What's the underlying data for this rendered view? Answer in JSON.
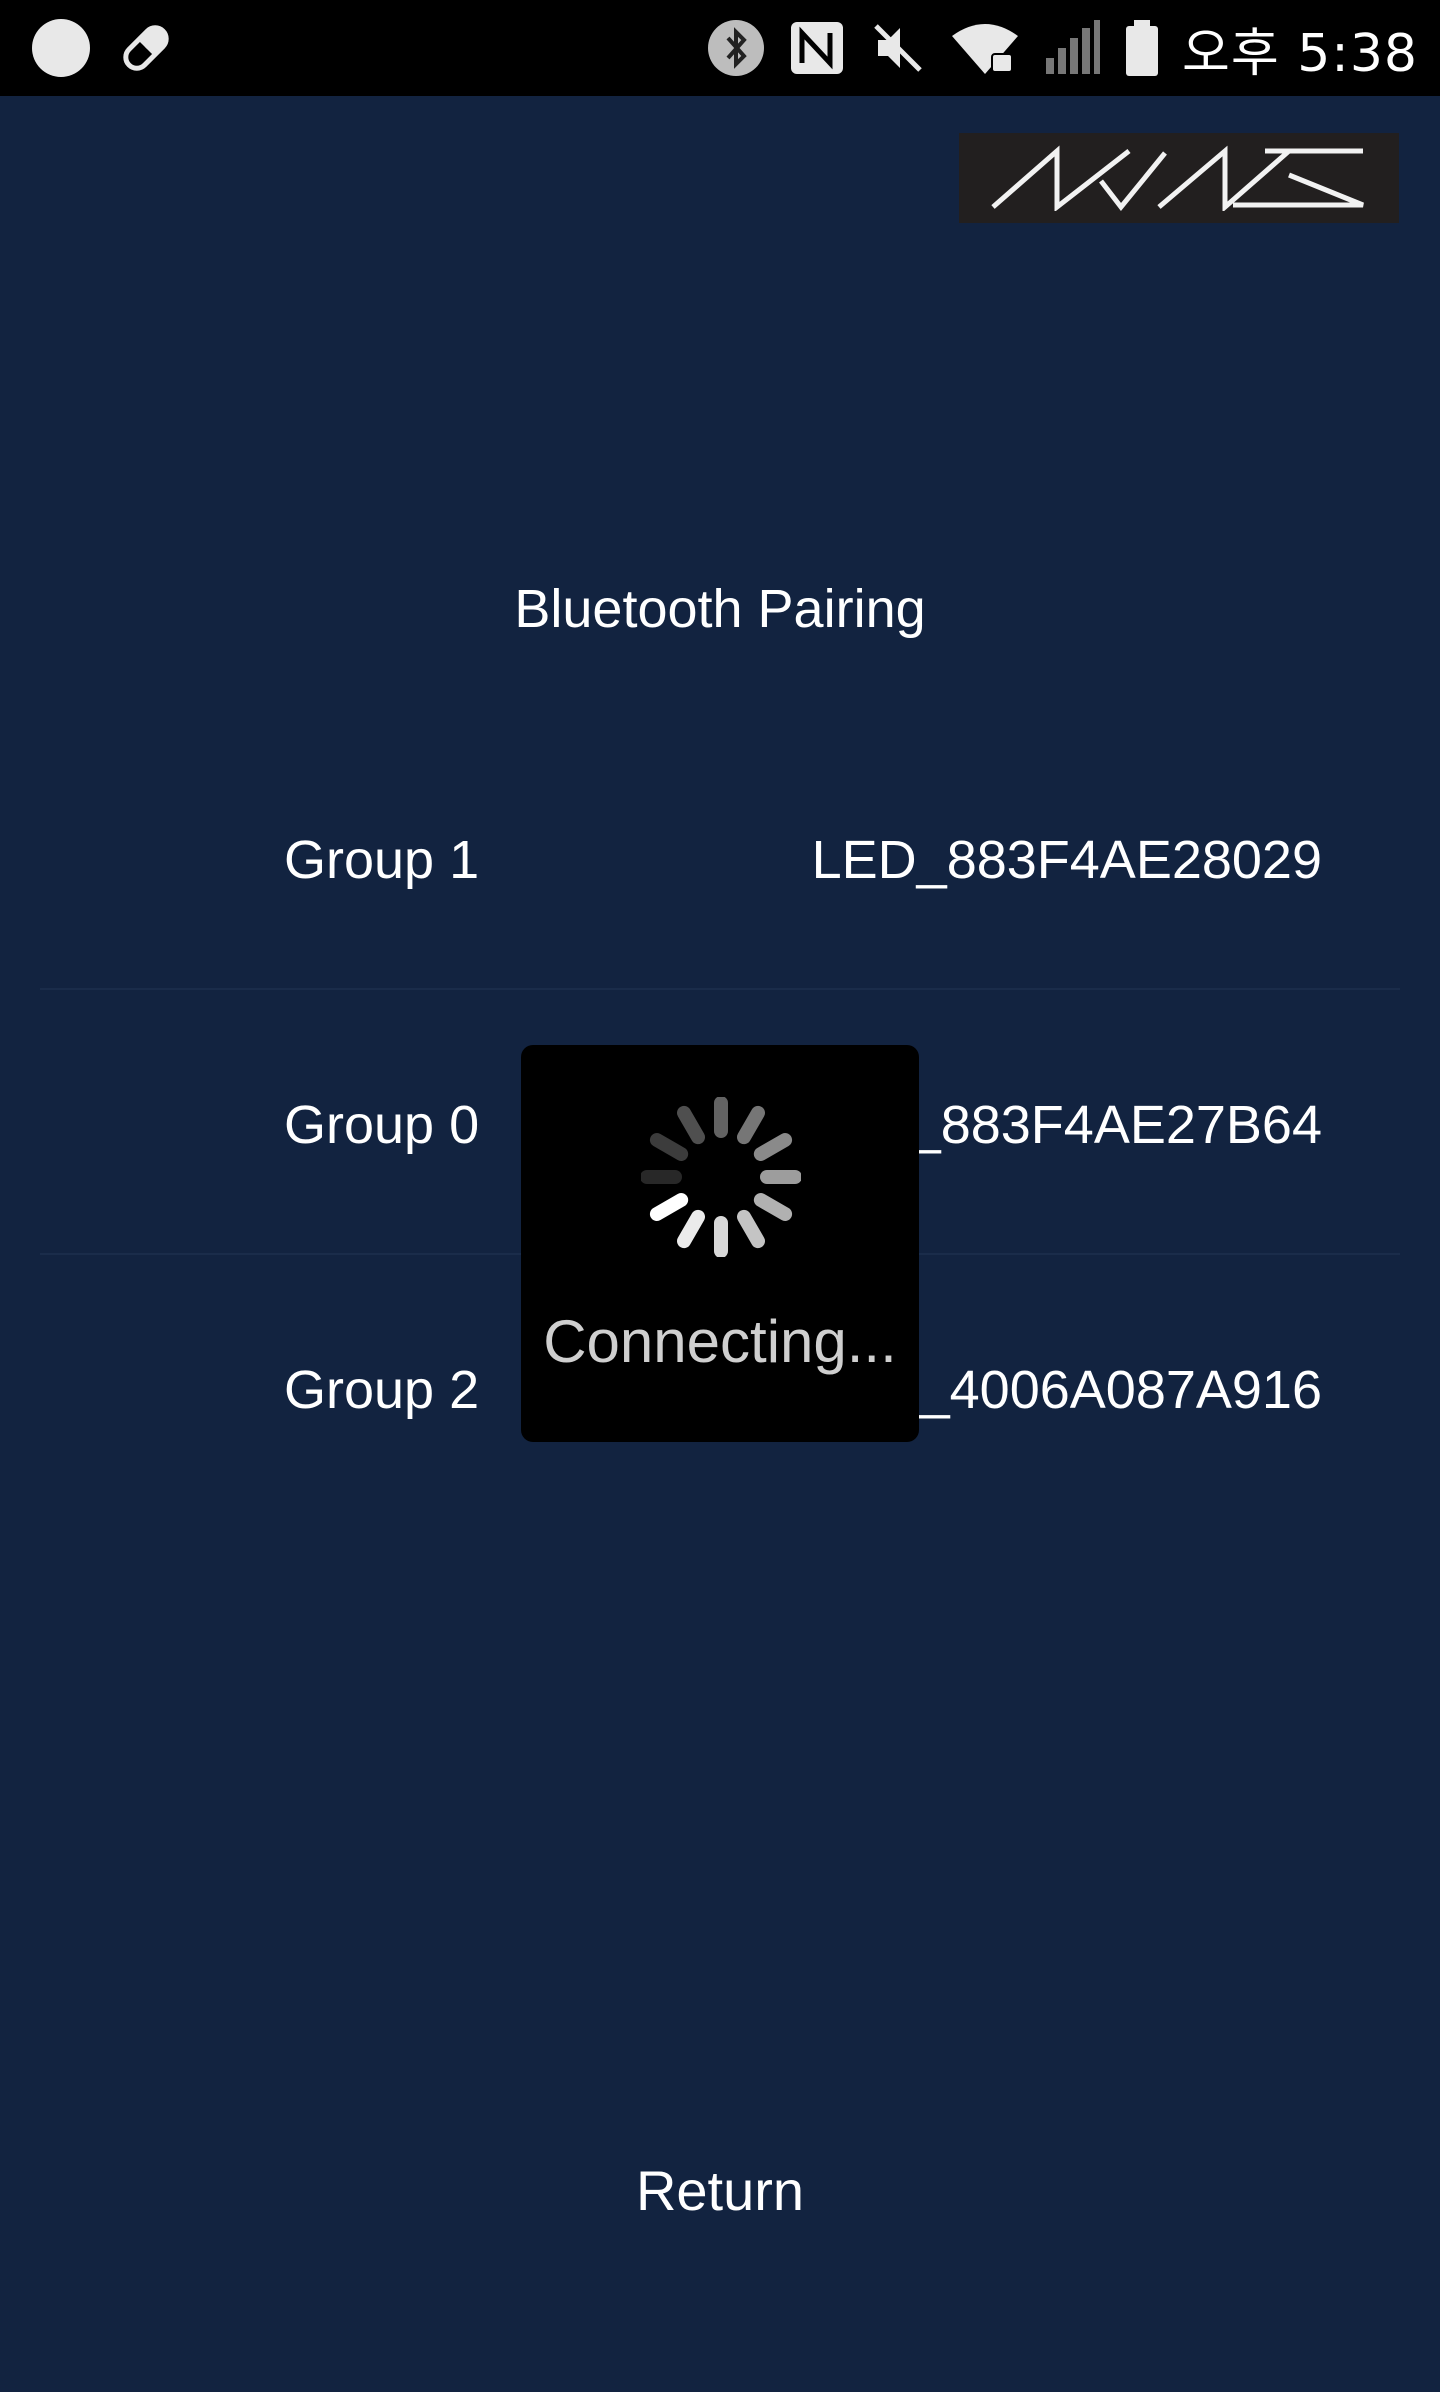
{
  "status_bar": {
    "time": "오후 5:38",
    "left_icons": [
      "circle-icon",
      "pill-icon"
    ],
    "right_icons": [
      "bluetooth-icon",
      "nfc-icon",
      "mute-icon",
      "wifi-lock-icon",
      "signal-icon",
      "battery-icon"
    ]
  },
  "header": {
    "logo_alt": "NAVAS"
  },
  "page": {
    "title": "Bluetooth Pairing"
  },
  "devices": [
    {
      "group": "Group 1",
      "name": "LED_883F4AE28029"
    },
    {
      "group": "Group 0",
      "name": "_883F4AE27B64"
    },
    {
      "group": "Group 2",
      "name": "_4006A087A916"
    }
  ],
  "dialog": {
    "message": "Connecting..."
  },
  "footer": {
    "return_label": "Return"
  }
}
